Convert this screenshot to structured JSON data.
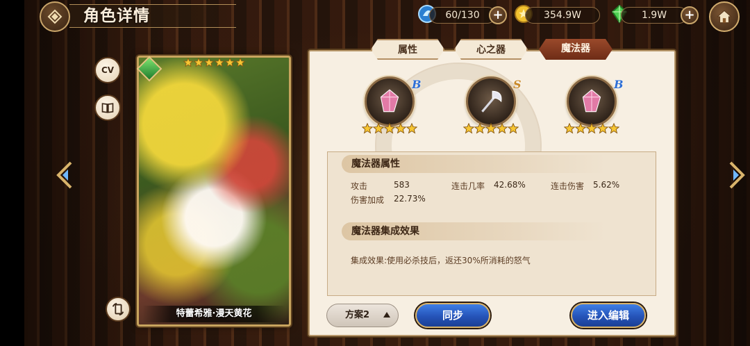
{
  "header": {
    "title": "角色详情"
  },
  "resources": {
    "stamina": "60/130",
    "gold": "354.9W",
    "gems": "1.9W"
  },
  "colors": {
    "accent_brown": "#6e2c16",
    "panel_bg": "#f7efe2",
    "button_blue": "#2553b8",
    "gold_border": "#c8a45e",
    "grade_b": "#2e6fd6",
    "grade_s": "#c98a2a"
  },
  "side_buttons": {
    "cv_label": "CV"
  },
  "card": {
    "name": "特蕾希雅·漫天黄花",
    "stars": 6
  },
  "tabs": [
    {
      "label": "属性",
      "active": false
    },
    {
      "label": "心之器",
      "active": false
    },
    {
      "label": "魔法器",
      "active": true
    }
  ],
  "slots": [
    {
      "grade": "B",
      "stars": 5,
      "icon": "crystal-icon"
    },
    {
      "grade": "S",
      "stars": 5,
      "icon": "axe-icon"
    },
    {
      "grade": "B",
      "stars": 5,
      "icon": "crystal-icon"
    }
  ],
  "attributes": {
    "heading": "魔法器属性",
    "items": [
      {
        "label": "攻击",
        "value": "583"
      },
      {
        "label": "连击几率",
        "value": "42.68%"
      },
      {
        "label": "连击伤害",
        "value": "5.62%"
      },
      {
        "label": "伤害加成",
        "value": "22.73%"
      }
    ]
  },
  "set_effect": {
    "heading": "魔法器集成效果",
    "text": "集成效果:使用必杀技后，返还30%所消耗的怒气"
  },
  "bottom": {
    "scheme": "方案2",
    "sync": "同步",
    "edit": "进入编辑"
  }
}
